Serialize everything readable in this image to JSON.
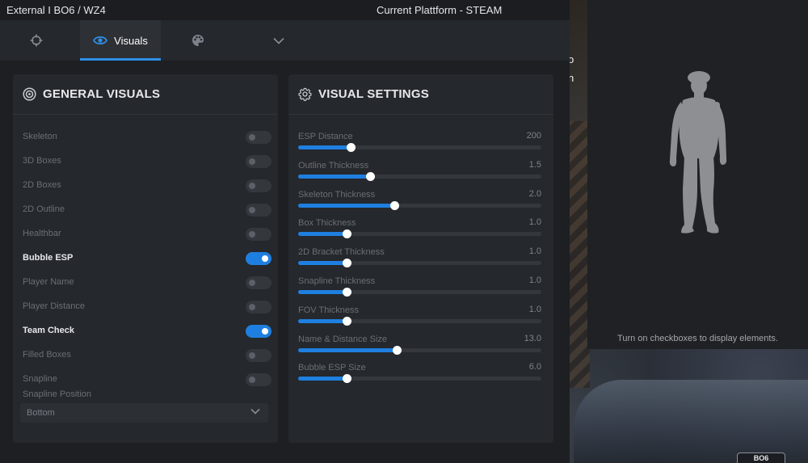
{
  "window": {
    "title": "External I BO6 / WZ4",
    "platform": "Current Plattform - STEAM"
  },
  "tabs": [
    {
      "icon": "crosshair-icon",
      "label": ""
    },
    {
      "icon": "eye-icon",
      "label": "Visuals",
      "active": true
    },
    {
      "icon": "palette-icon",
      "label": ""
    },
    {
      "icon": "chevron-down-icon",
      "label": ""
    }
  ],
  "general_visuals": {
    "title": "GENERAL VISUALS",
    "options": [
      {
        "label": "Skeleton",
        "enabled": false
      },
      {
        "label": "3D Boxes",
        "enabled": false
      },
      {
        "label": "2D Boxes",
        "enabled": false
      },
      {
        "label": "2D Outline",
        "enabled": false
      },
      {
        "label": "Healthbar",
        "enabled": false
      },
      {
        "label": "Bubble ESP",
        "enabled": true
      },
      {
        "label": "Player Name",
        "enabled": false
      },
      {
        "label": "Player Distance",
        "enabled": false
      },
      {
        "label": "Team Check",
        "enabled": true
      },
      {
        "label": "Filled Boxes",
        "enabled": false
      },
      {
        "label": "Snapline",
        "enabled": false
      }
    ],
    "snapline_position_label": "Snapline Position",
    "snapline_position_value": "Bottom"
  },
  "visual_settings": {
    "title": "VISUAL SETTINGS",
    "sliders": [
      {
        "label": "ESP Distance",
        "value": "200",
        "fraction": 0.215
      },
      {
        "label": "Outline Thickness",
        "value": "1.5",
        "fraction": 0.297
      },
      {
        "label": "Skeleton Thickness",
        "value": "2.0",
        "fraction": 0.395
      },
      {
        "label": "Box Thickness",
        "value": "1.0",
        "fraction": 0.199
      },
      {
        "label": "2D Bracket Thickness",
        "value": "1.0",
        "fraction": 0.199
      },
      {
        "label": "Snapline Thickness",
        "value": "1.0",
        "fraction": 0.199
      },
      {
        "label": "FOV Thickness",
        "value": "1.0",
        "fraction": 0.199
      },
      {
        "label": "Name & Distance Size",
        "value": "13.0",
        "fraction": 0.405
      },
      {
        "label": "Bubble ESP Size",
        "value": "6.0",
        "fraction": 0.199
      }
    ]
  },
  "preview": {
    "hint": "Turn on checkboxes to display elements."
  },
  "game": {
    "visible_letters": [
      "o",
      "n"
    ],
    "badge": "BO6"
  },
  "colors": {
    "accent": "#1f7fe0",
    "panel": "#25282c",
    "window": "#1d1f22"
  }
}
